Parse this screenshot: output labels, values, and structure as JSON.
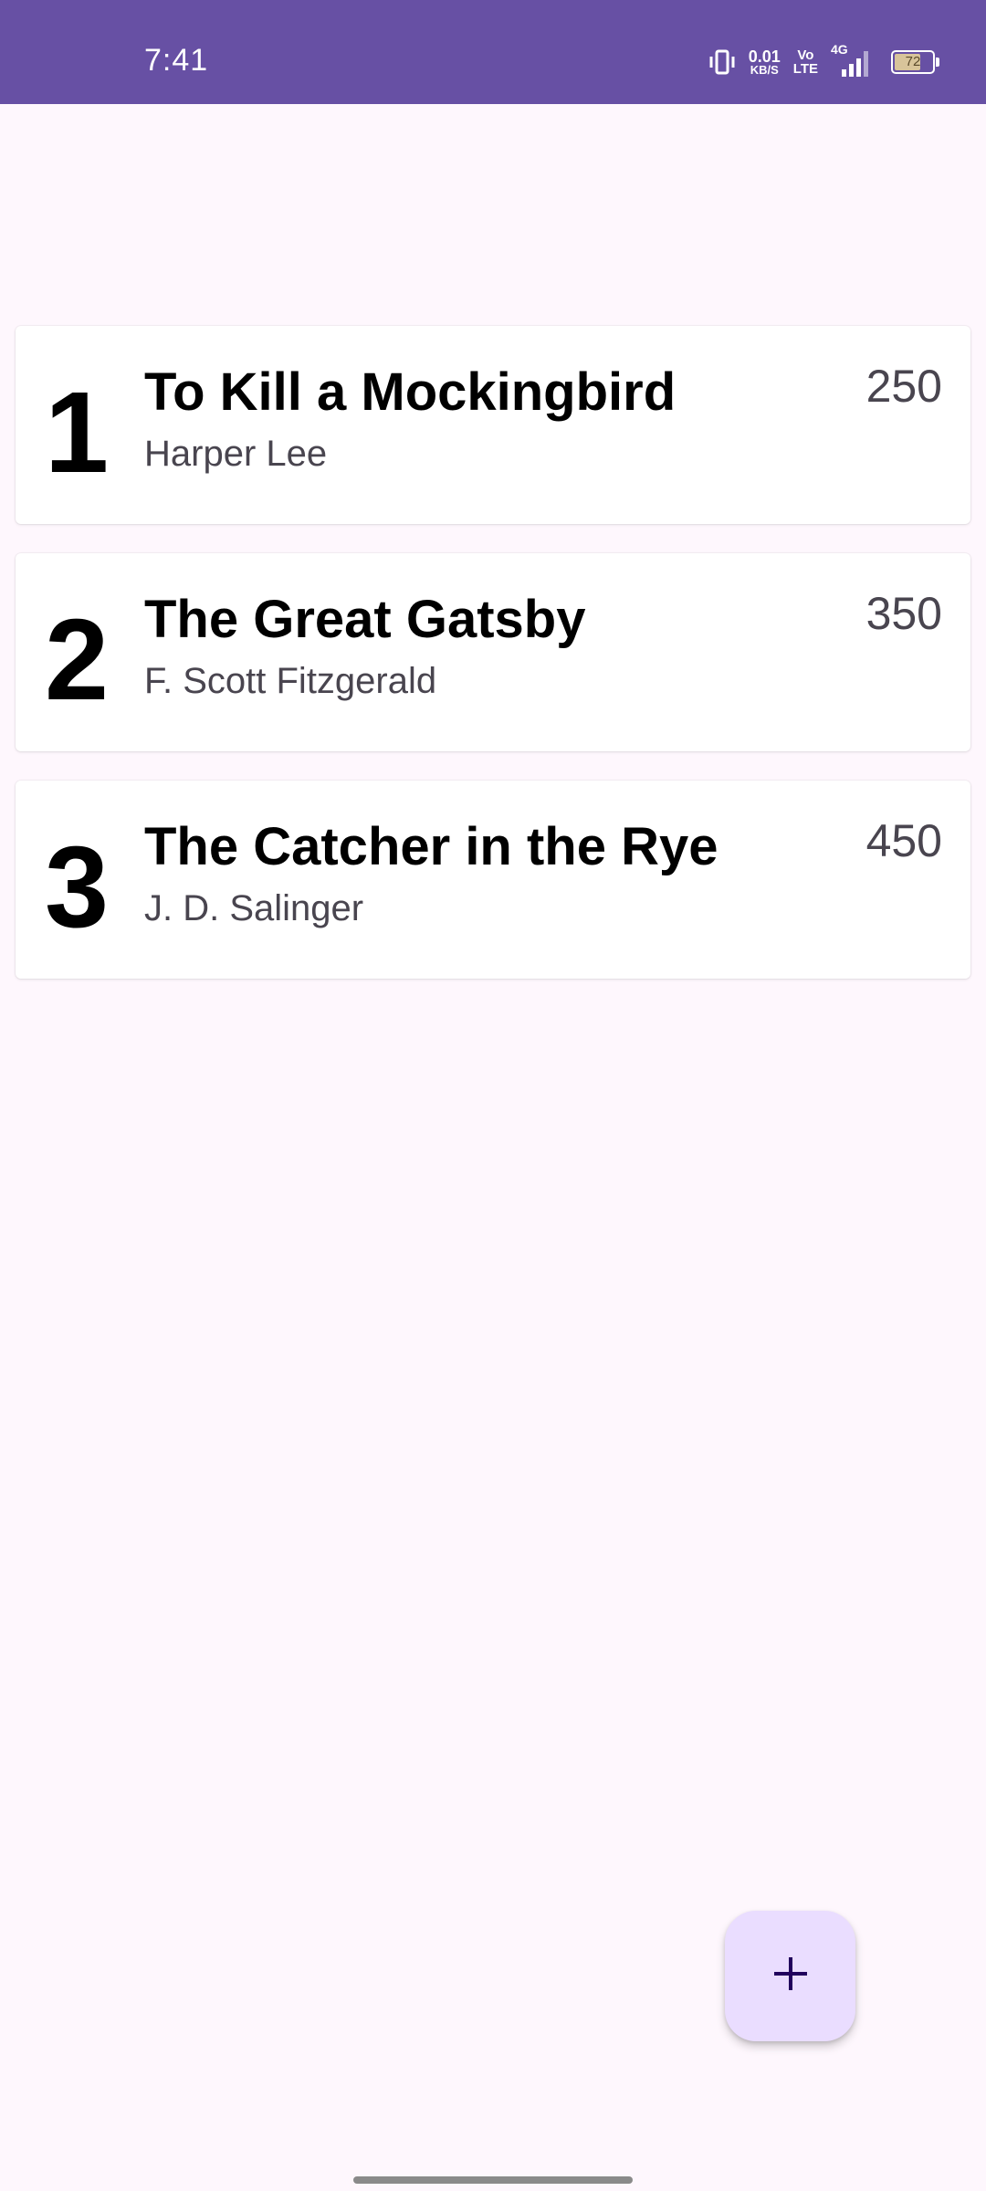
{
  "status_bar": {
    "time": "7:41",
    "net_speed_value": "0.01",
    "net_speed_unit": "KB/S",
    "volte_top": "Vo",
    "volte_bottom": "LTE",
    "network_type": "4G",
    "battery_level": "72",
    "battery_fraction": 0.72,
    "bar_color": "#6750a4"
  },
  "books": [
    {
      "rank": "1",
      "title": "To Kill a Mockingbird",
      "author": "Harper Lee",
      "pages": "250"
    },
    {
      "rank": "2",
      "title": "The Great Gatsby",
      "author": "F. Scott Fitzgerald",
      "pages": "350"
    },
    {
      "rank": "3",
      "title": "The Catcher in the Rye",
      "author": "J. D. Salinger",
      "pages": "450"
    }
  ],
  "fab": {
    "icon": "plus-icon",
    "color": "#eaddff"
  }
}
